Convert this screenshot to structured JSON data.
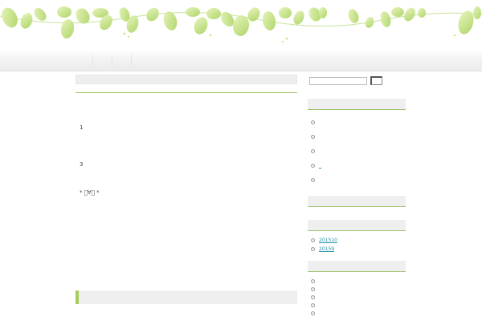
{
  "header": {
    "nav_items": [
      "",
      "",
      ""
    ]
  },
  "main": {
    "post_lines": [
      "1",
      "3",
      "* ゚∀゚ *"
    ]
  },
  "sidebar": {
    "search": {
      "value": "",
      "button_label": ""
    },
    "widget1_links": [
      "",
      "",
      "",
      "_",
      ""
    ],
    "archives": [
      "201510",
      "20159"
    ],
    "widget4_items": [
      "",
      "",
      "",
      "",
      ""
    ]
  },
  "colors": {
    "accent_green": "#9cc26a",
    "link_blue": "#2a8fa6",
    "bar_gray": "#efefef"
  }
}
